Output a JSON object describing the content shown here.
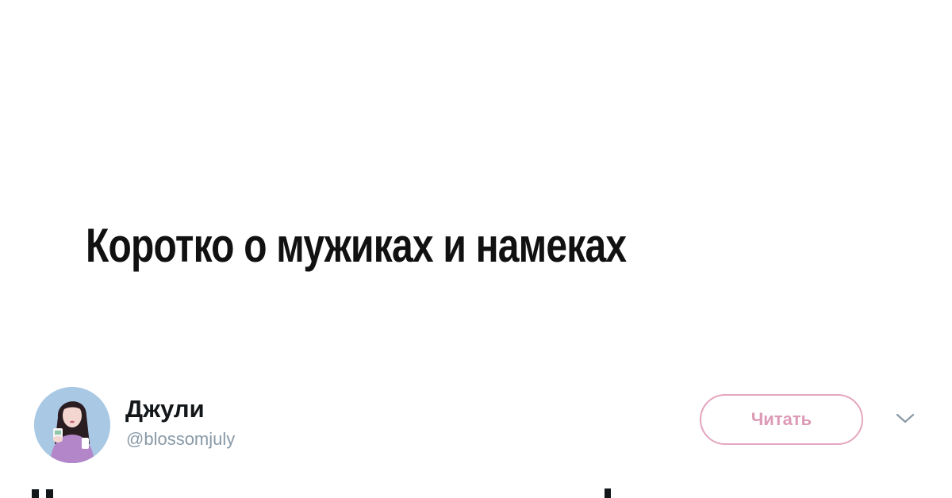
{
  "headline": "Коротко о мужиках и намеках",
  "tweet": {
    "author": {
      "display_name": "Джули",
      "handle": "@blossomjuly",
      "avatar_icon": "avatar-illustration"
    },
    "follow_button_label": "Читать",
    "menu_icon": "chevron-down-icon"
  },
  "colors": {
    "background": "#ffffff",
    "headline": "#111111",
    "name": "#14171a",
    "handle": "#8899a6",
    "follow_accent": "#dd9ab6"
  }
}
